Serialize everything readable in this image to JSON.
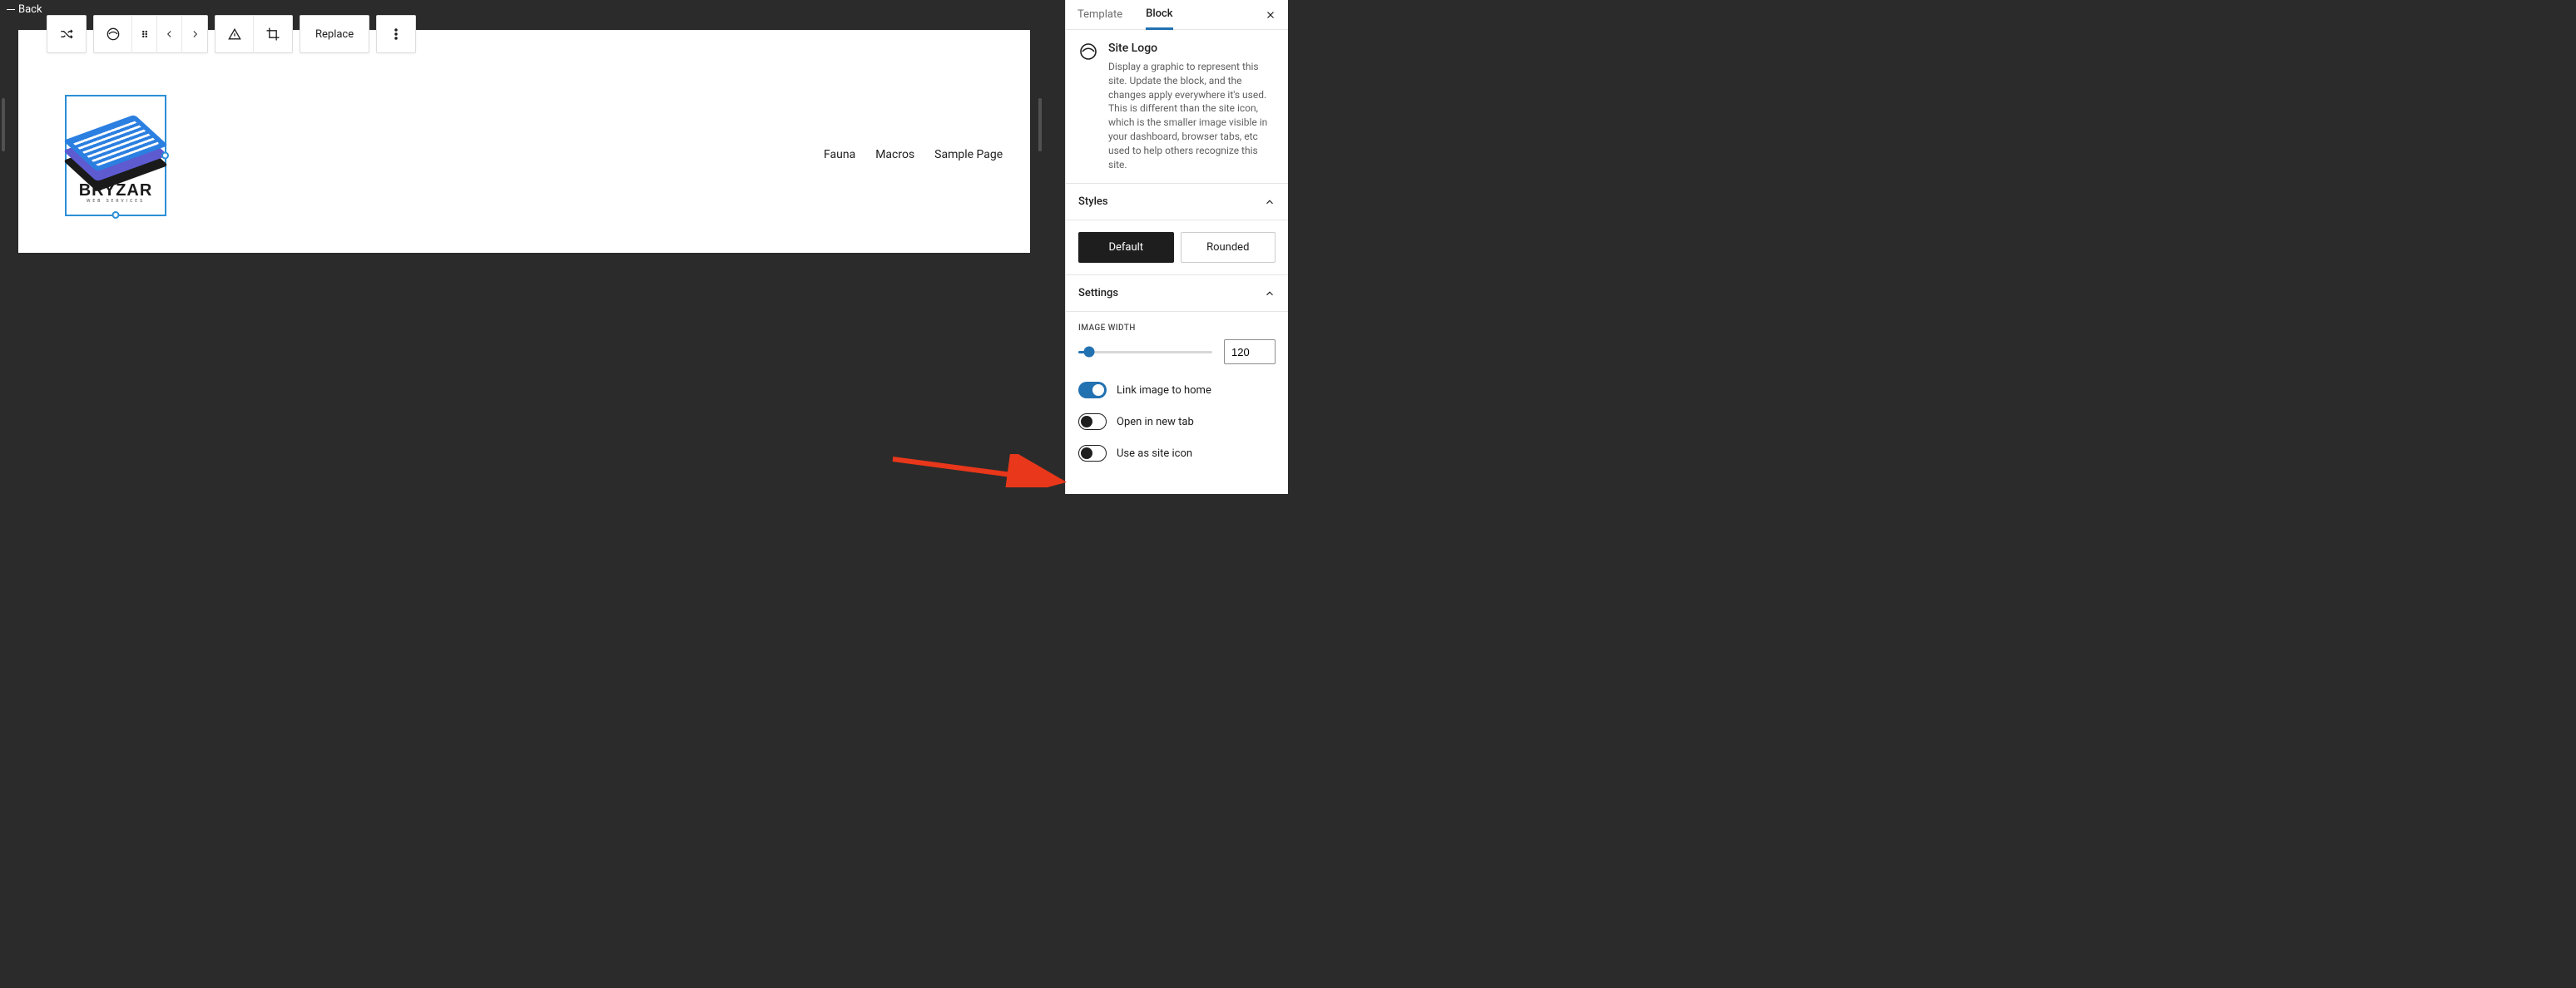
{
  "back": "Back",
  "toolbar": {
    "replace": "Replace"
  },
  "logo": {
    "name": "BRYZAR",
    "tag": "WEB SERVICES"
  },
  "nav": [
    "Fauna",
    "Macros",
    "Sample Page"
  ],
  "sidebar": {
    "tabs": {
      "template": "Template",
      "block": "Block"
    },
    "block": {
      "title": "Site Logo",
      "desc": "Display a graphic to represent this site. Update the block, and the changes apply everywhere it's used. This is different than the site icon, which is the smaller image visible in your dashboard, browser tabs, etc used to help others recognize this site."
    },
    "styles": {
      "heading": "Styles",
      "default": "Default",
      "rounded": "Rounded"
    },
    "settings": {
      "heading": "Settings",
      "image_width_label": "IMAGE WIDTH",
      "image_width_value": "120",
      "link_home": "Link image to home",
      "new_tab": "Open in new tab",
      "site_icon": "Use as site icon"
    }
  }
}
